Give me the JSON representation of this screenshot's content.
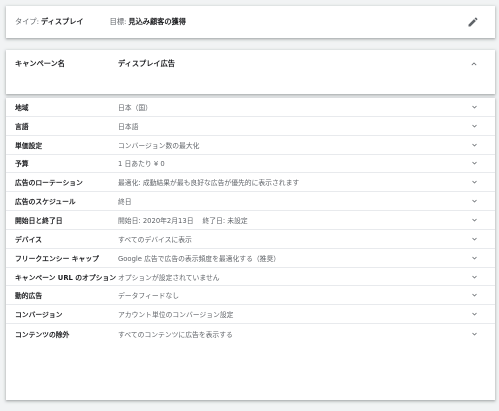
{
  "summary": {
    "type_label": "タイプ:",
    "type_value": "ディスプレイ",
    "goal_label": "目標:",
    "goal_value": "見込み顧客の獲得",
    "edit_icon": "pencil-icon"
  },
  "campaign": {
    "label": "キャンペーン名",
    "value": "ディスプレイ広告",
    "toggle_icon": "chevron-up-icon"
  },
  "settings": {
    "rows": [
      {
        "label": "地域",
        "value": "日本（国）"
      },
      {
        "label": "言語",
        "value": "日本語"
      },
      {
        "label": "単価設定",
        "value": "コンバージョン数の最大化"
      },
      {
        "label": "予算",
        "value": "1 日あたり ¥ 0"
      },
      {
        "label": "広告のローテーション",
        "value": "最適化: 成動結果が最も良好な広告が優先的に表示されます"
      },
      {
        "label": "広告のスケジュール",
        "value": "終日"
      },
      {
        "label": "開始日と終了日",
        "value": "開始日: 2020年2月13日　 終了日: 未設定"
      },
      {
        "label": "デバイス",
        "value": "すべてのデバイスに表示"
      },
      {
        "label": "フリークエンシー キャップ",
        "value": "Google 広告で広告の表示頻度を最適化する（推奨）"
      },
      {
        "label": "キャンペーン URL のオプション",
        "value": "オプションが設定されていません"
      },
      {
        "label": "動的広告",
        "value": "データフィードなし"
      },
      {
        "label": "コンバージョン",
        "value": "アカウント単位のコンバージョン設定"
      },
      {
        "label": "コンテンツの除外",
        "value": "すべてのコンテンツに広告を表示する"
      }
    ],
    "row_icon": "chevron-down-icon"
  },
  "colors": {
    "background": "#f1f3f4",
    "card": "#ffffff",
    "label_text": "#202124",
    "value_text": "#5f6368",
    "divider": "#e8eaed"
  }
}
